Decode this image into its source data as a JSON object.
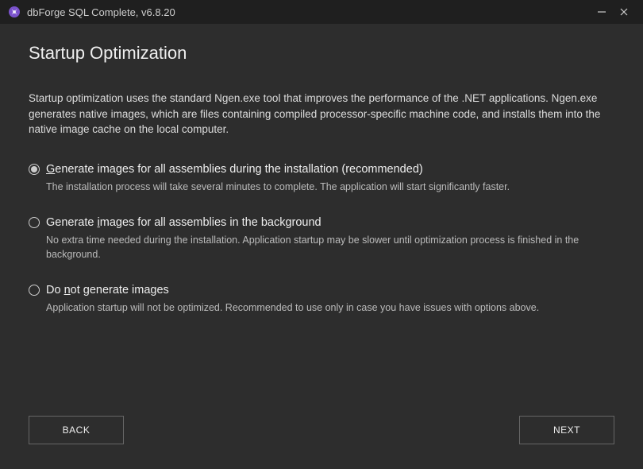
{
  "titlebar": {
    "title": "dbForge SQL Complete, v6.8.20"
  },
  "page": {
    "heading": "Startup Optimization",
    "description": "Startup optimization uses the standard Ngen.exe tool that improves the performance of the .NET applications. Ngen.exe generates native images, which are files containing compiled processor-specific machine code, and installs them into the native image cache on the local computer."
  },
  "options": [
    {
      "selected": true,
      "accel": "G",
      "label_pre": "",
      "label_post": "enerate images for all assemblies during the installation (recommended)",
      "desc": "The installation process will take several minutes to complete. The application will start significantly faster."
    },
    {
      "selected": false,
      "accel": "i",
      "label_pre": "Generate ",
      "label_post": "mages for all assemblies in the background",
      "desc": "No extra time needed during the installation. Application startup may be slower until optimization process is finished in the background."
    },
    {
      "selected": false,
      "accel": "n",
      "label_pre": "Do ",
      "label_post": "ot generate images",
      "desc": "Application startup will not be optimized. Recommended to use only in case you have issues with options above."
    }
  ],
  "buttons": {
    "back": "BACK",
    "next": "NEXT"
  }
}
